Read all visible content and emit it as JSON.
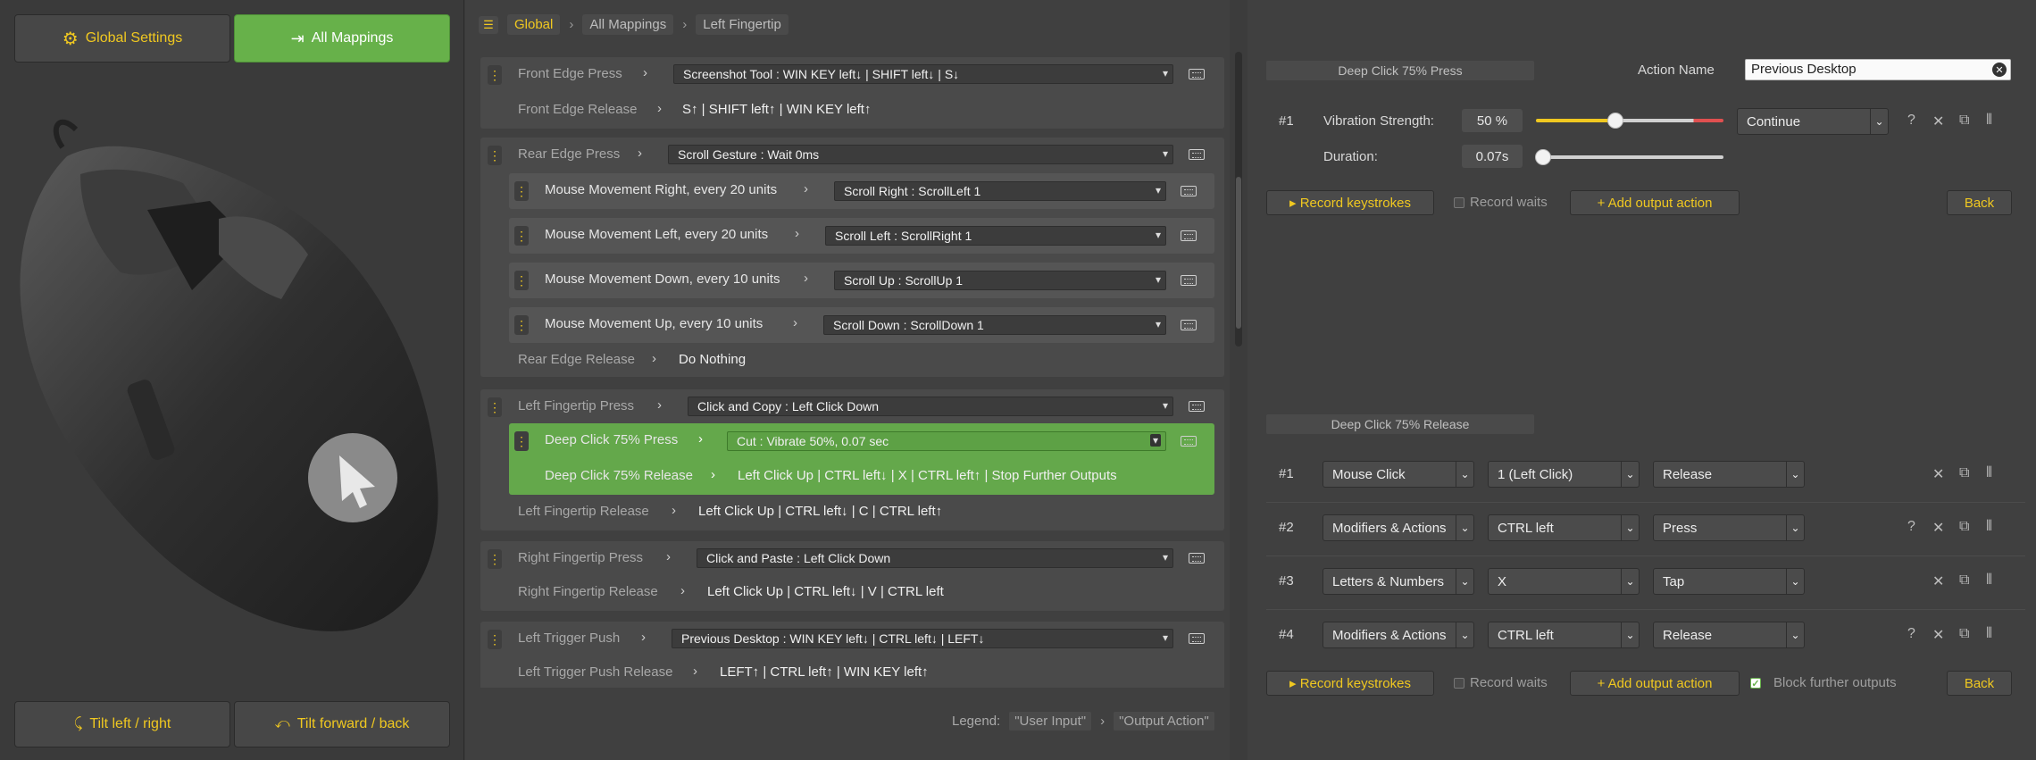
{
  "left": {
    "global_settings": "Global Settings",
    "all_mappings": "All Mappings",
    "tilt_lr": "Tilt left / right",
    "tilt_fb": "Tilt forward / back"
  },
  "breadcrumb": [
    "Global",
    "All Mappings",
    "Left Fingertip"
  ],
  "groups": {
    "front": {
      "press": "Front Edge Press",
      "press_action": "Screenshot Tool : WIN KEY left↓ | SHIFT left↓ | S↓",
      "release": "Front Edge Release",
      "release_action": "S↑ | SHIFT left↑ | WIN KEY left↑"
    },
    "rear": {
      "press": "Rear Edge Press",
      "press_action": "Scroll Gesture : Wait 0ms",
      "subs": [
        {
          "label": "Mouse Movement Right, every 20 units",
          "action": "Scroll Right : ScrollLeft 1"
        },
        {
          "label": "Mouse Movement Left, every 20 units",
          "action": "Scroll Left : ScrollRight 1"
        },
        {
          "label": "Mouse Movement Down, every 10 units",
          "action": "Scroll Up : ScrollUp 1"
        },
        {
          "label": "Mouse Movement Up, every 10 units",
          "action": "Scroll Down : ScrollDown 1"
        }
      ],
      "release": "Rear Edge Release",
      "release_action": "Do Nothing"
    },
    "lf": {
      "press": "Left Fingertip Press",
      "press_action": "Click and Copy : Left Click Down",
      "deep_press": "Deep Click 75% Press",
      "deep_press_action": "Cut : Vibrate 50%, 0.07 sec",
      "deep_release": "Deep Click 75% Release",
      "deep_release_action": "Left Click Up | CTRL left↓ | X | CTRL left↑ | Stop Further Outputs",
      "release": "Left Fingertip Release",
      "release_action": "Left Click Up | CTRL left↓ | C | CTRL left↑"
    },
    "rf": {
      "press": "Right Fingertip Press",
      "press_action": "Click and Paste : Left Click Down",
      "release": "Right Fingertip Release",
      "release_action": "Left Click Up | CTRL left↓ | V | CTRL left"
    },
    "lt": {
      "press": "Left Trigger Push",
      "press_action": "Previous Desktop : WIN KEY left↓ | CTRL left↓ | LEFT↓",
      "release": "Left Trigger Push Release",
      "release_action": "LEFT↑ | CTRL left↑ | WIN KEY left↑"
    }
  },
  "legend": {
    "label": "Legend:",
    "input": "\"User Input\"",
    "output": "\"Output Action\""
  },
  "editor": {
    "press_title": "Deep Click 75% Press",
    "action_name_label": "Action Name",
    "action_name_value": "Previous Desktop",
    "p1_num": "#1",
    "vib_label": "Vibration Strength:",
    "vib_value": "50 %",
    "vib_level": 0.5,
    "dur_label": "Duration:",
    "dur_value": "0.07s",
    "p1_mode": "Continue",
    "record": "▸ Record keystrokes",
    "record_waits": "Record waits",
    "add_output": "+ Add output action",
    "back": "Back",
    "release_title": "Deep Click 75% Release",
    "release_rows": [
      {
        "num": "#1",
        "a": "Mouse Click",
        "b": "1 (Left Click)",
        "c": "Release"
      },
      {
        "num": "#2",
        "a": "Modifiers & Actions",
        "b": "CTRL left",
        "c": "Press"
      },
      {
        "num": "#3",
        "a": "Letters & Numbers",
        "b": "X",
        "c": "Tap"
      },
      {
        "num": "#4",
        "a": "Modifiers & Actions",
        "b": "CTRL left",
        "c": "Release"
      }
    ],
    "block_further": "Block further outputs"
  }
}
